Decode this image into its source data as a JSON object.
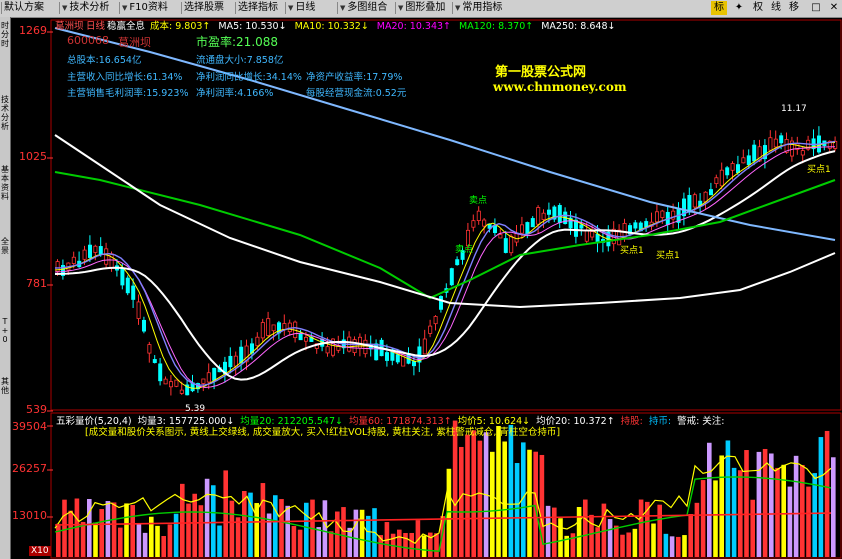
{
  "toolbar": {
    "items": [
      {
        "label": "默认方案",
        "arrow": false
      },
      {
        "label": "技术分析",
        "arrow": true
      },
      {
        "label": "F10资料",
        "arrow": true
      },
      {
        "label": "选择股票",
        "arrow": false
      },
      {
        "label": "选择指标",
        "arrow": false
      },
      {
        "label": "日线",
        "arrow": true
      },
      {
        "label": "多图组合",
        "arrow": true
      },
      {
        "label": "图形叠加",
        "arrow": true
      },
      {
        "label": "常用指标",
        "arrow": true
      }
    ],
    "right_buttons": [
      "标",
      "✦",
      "权",
      "线",
      "移"
    ],
    "window_controls": [
      "□",
      "✕"
    ]
  },
  "sidebar": {
    "tabs": [
      "时分时",
      "技术分析",
      "基本资料",
      "全景",
      "T+0",
      "其他"
    ]
  },
  "price_scale": {
    "values": [
      "1269",
      "1025",
      "781",
      "539"
    ],
    "low_marker": "5.39",
    "high_marker": "11.17"
  },
  "volume_scale": {
    "values": [
      "39504",
      "26257",
      "13010"
    ],
    "unit": "X10"
  },
  "header": {
    "stock_name": "葛洲坝",
    "period": "日线",
    "stock_name2": "稳赢全息",
    "ma_items": [
      {
        "label": "成本:",
        "value": "9.803↑",
        "color": "#ffff00"
      },
      {
        "label": "MA5:",
        "value": "10.530↓",
        "color": "#ffffff"
      },
      {
        "label": "MA10:",
        "value": "10.332↓",
        "color": "#ffff00"
      },
      {
        "label": "MA20:",
        "value": "10.343↑",
        "color": "#ff00ff"
      },
      {
        "label": "MA120:",
        "value": "8.370↑",
        "color": "#00ff00"
      },
      {
        "label": "MA250:",
        "value": "8.648↓",
        "color": "#ffffff"
      }
    ]
  },
  "stock_info": {
    "code": "600068",
    "name": "葛洲坝",
    "pe": "市盈率:21.088",
    "total_shares": "总股本:16.654亿",
    "float_shares": "流通盘大小:7.858亿",
    "row2": [
      "主营收入同比增长:61.34%",
      "净利润同比增长:34.14%",
      "净资产收益率:17.79%"
    ],
    "row3": [
      "主营销售毛利润率:15.923%",
      "净利润率:4.166%",
      "每股经营现金流:0.52元"
    ]
  },
  "watermark": {
    "line1": "第一股票公式网",
    "line2": "www.chnmoney.com"
  },
  "annotations": [
    "卖点",
    "买点1",
    "买点1",
    "买点1",
    "卖点"
  ],
  "volume_header": {
    "title": "五彩量价(5,20,4)",
    "items": [
      {
        "text": "均量3: 157725.000↓",
        "color": "#ffffff"
      },
      {
        "text": "均量20: 212205.547↓",
        "color": "#00ff00"
      },
      {
        "text": "均量60: 171874.313↑",
        "color": "#ff3333"
      },
      {
        "text": "均价5: 10.624↓",
        "color": "#ffff00"
      },
      {
        "text": "均价20: 10.372↑",
        "color": "#ffffff"
      },
      {
        "text": "持股:",
        "color": "#ff3333"
      },
      {
        "text": "持币:",
        "color": "#00bfff"
      },
      {
        "text": "警戒: 关注:",
        "color": "#ffffff"
      }
    ],
    "legend": "[成交量和股价关系图示, 黄线上交绿线, 成交量放大, 买入!红柱VOL持股, 黄柱关注, 紫柱警戒减仓, 青柱空仓持币]"
  },
  "colors": {
    "up": "#ff3333",
    "down": "#00ffff",
    "bg": "#000000",
    "frame": "#aa0000"
  }
}
